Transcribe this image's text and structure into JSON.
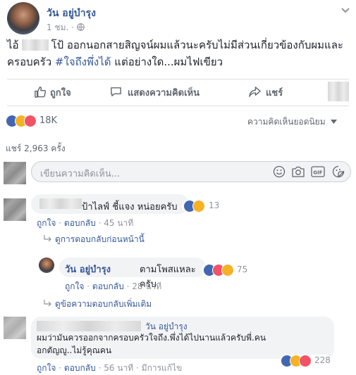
{
  "post": {
    "author": "วัน อยู่บำรุง",
    "time": "1 ชม.",
    "text_line1_a": "ไอ้",
    "text_line1_b": "โป้ ออกนอกสายสิญจน์ผมแล้วนะครับไม่มีส่วนเกี่ยวข้องกับผมและ",
    "text_line2_a": "ครอบครัว",
    "hashtag": "#ใจถึงพึ่งได้",
    "text_line2_b": "แต่อย่างใด...ผมไฟเขียว"
  },
  "actions": {
    "like": "ถูกใจ",
    "comment": "แสดงความคิดเห็น",
    "share": "แชร์"
  },
  "reactions": {
    "count": "18K",
    "sort": "ความคิดเห็นยอดนิยม"
  },
  "shares": "แชร์ 2,963 ครั้ง",
  "composer": {
    "placeholder": "เขียนความคิดเห็น..."
  },
  "comments": [
    {
      "text": "ป้าไลฟ์ ชี้แจง หน่อยครับ",
      "reaction_count": "13",
      "like": "ถูกใจ",
      "reply": "ตอบกลับ",
      "time": "45 นาที",
      "prev_replies": "ดูการตอบกลับก่อนหน้านี้"
    },
    {
      "author": "วัน อยู่บำรุง",
      "text": "ตามโพสแหละครับ",
      "reaction_count": "75",
      "like": "ถูกใจ",
      "reply": "ตอบกลับ",
      "time": "28 นาที",
      "more_replies": "ดูข้อความตอบกลับเพิ่มเติม"
    },
    {
      "mention": "วัน อยู่บำรุง",
      "line1": "ผมว่ามันควรออกจากครอบครัวใจถึง.พึ่งได้ไปนานแล้วครับพี่.คน",
      "line2": "อกตัญญู..ไม่รู้คุณคน",
      "reaction_count": "228",
      "like": "ถูกใจ",
      "reply": "ตอบกลับ",
      "time": "56 นาที",
      "edited": "มีการแก้ไข"
    }
  ],
  "sep": "·",
  "colors": {
    "link": "#365899",
    "like_blue": "#4267b2",
    "love_red": "#f25268",
    "haha_yellow": "#f7b125"
  }
}
